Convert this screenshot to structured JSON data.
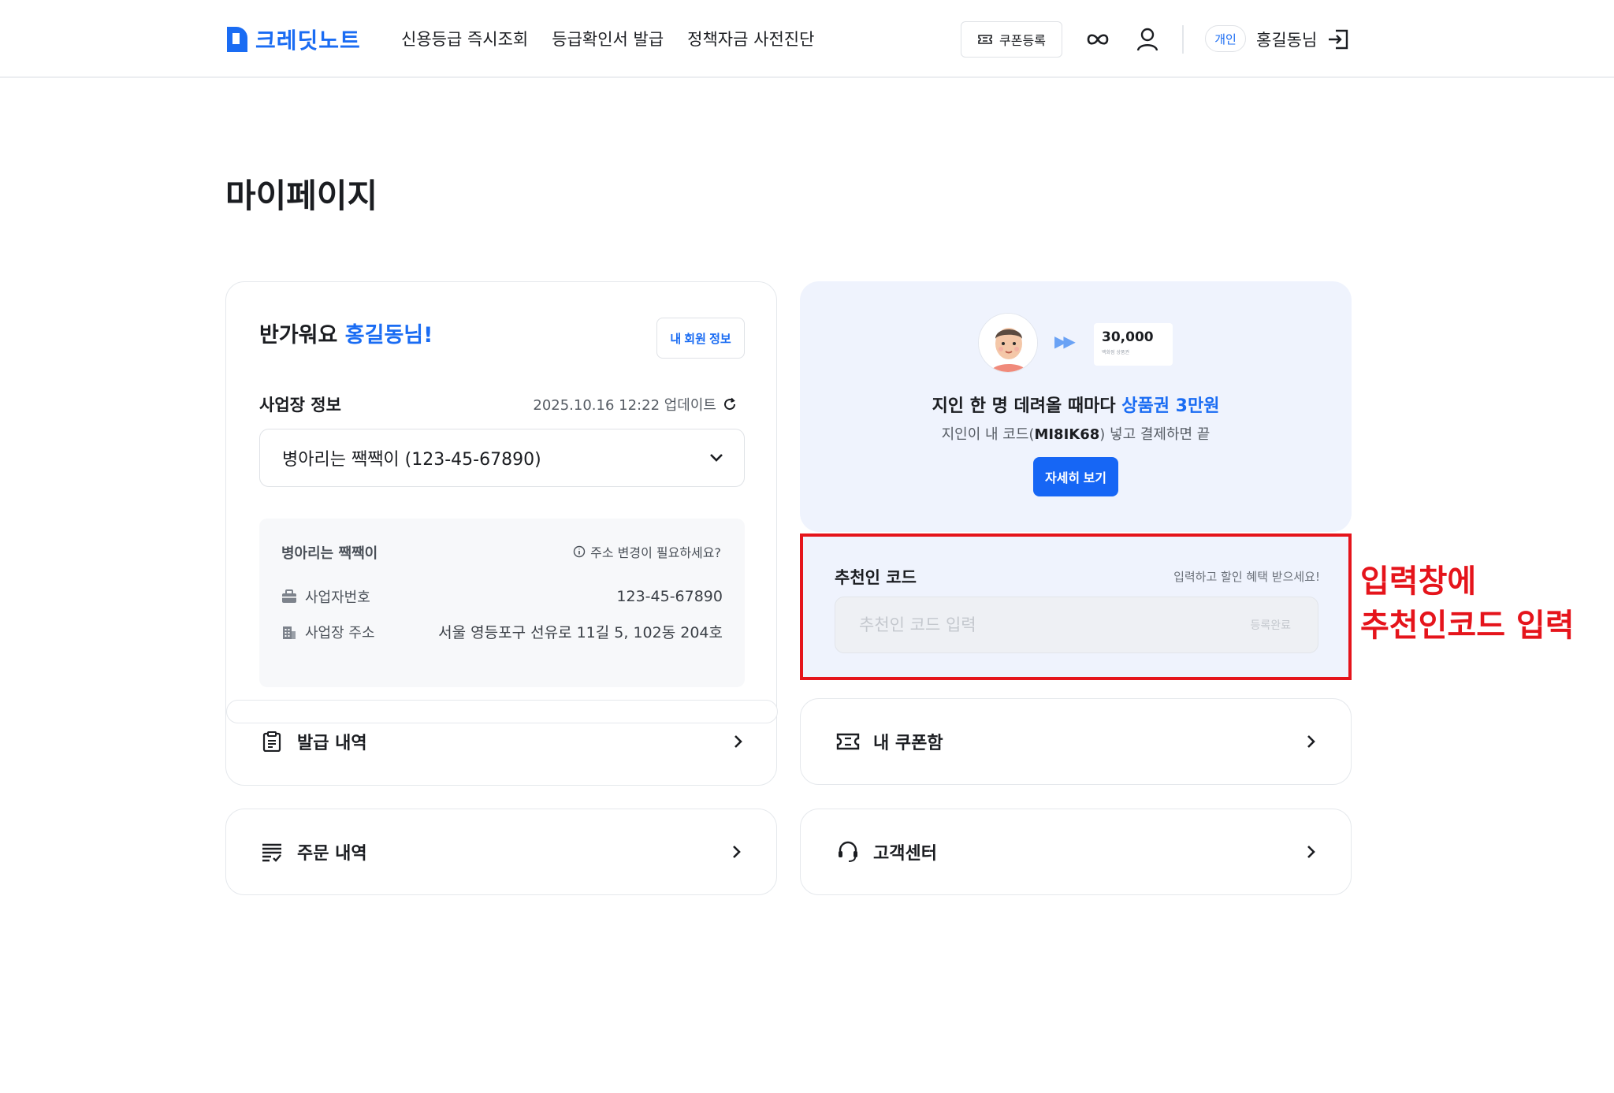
{
  "header": {
    "logo_text": "크레딧노트",
    "nav": [
      "신용등급 즉시조회",
      "등급확인서 발급",
      "정책자금 사전진단"
    ],
    "coupon_button": "쿠폰등록",
    "badge": "개인",
    "user_name": "홍길동님"
  },
  "page_title": "마이페이지",
  "profile": {
    "greeting_prefix": "반가워요 ",
    "greeting_name": "홍길동님!",
    "member_info_button": "내 회원 정보",
    "business_section_label": "사업장 정보",
    "updated_text": "2025.10.16 12:22 업데이트",
    "selected_business": "병아리는 짹짹이 (123-45-67890)",
    "business_name": "병아리는 짹짹이",
    "address_change_link": "주소 변경이 필요하세요?",
    "reg_number_label": "사업자번호",
    "reg_number_value": "123-45-67890",
    "address_label": "사업장 주소",
    "address_value": "서울 영등포구 선유로 11길 5, 102동 204호"
  },
  "menu": {
    "issue_history": "발급 내역",
    "order_history": "주문 내역",
    "coupon_box": "내 쿠폰함",
    "customer_center": "고객센터"
  },
  "promo": {
    "voucher_amount": "30,000",
    "voucher_sub": "백화점 상품권",
    "title_prefix": "지인 한 명 데려올 때마다 ",
    "title_highlight": "상품권 3만원",
    "sub_prefix": "지인이 내 코드(",
    "sub_code": "MI8IK68",
    "sub_suffix": ") 넣고 결제하면 끝",
    "detail_button": "자세히 보기"
  },
  "referral": {
    "label": "추천인 코드",
    "hint": "입력하고 할인 혜택 받으세요!",
    "placeholder": "추천인 코드 입력",
    "submit": "등록완료"
  },
  "annotation": {
    "line1": "입력창에",
    "line2": "추천인코드 입력"
  },
  "colors": {
    "brand": "#1a6cf3",
    "annotation_red": "#e5141b",
    "promo_bg": "#eff3fd"
  }
}
